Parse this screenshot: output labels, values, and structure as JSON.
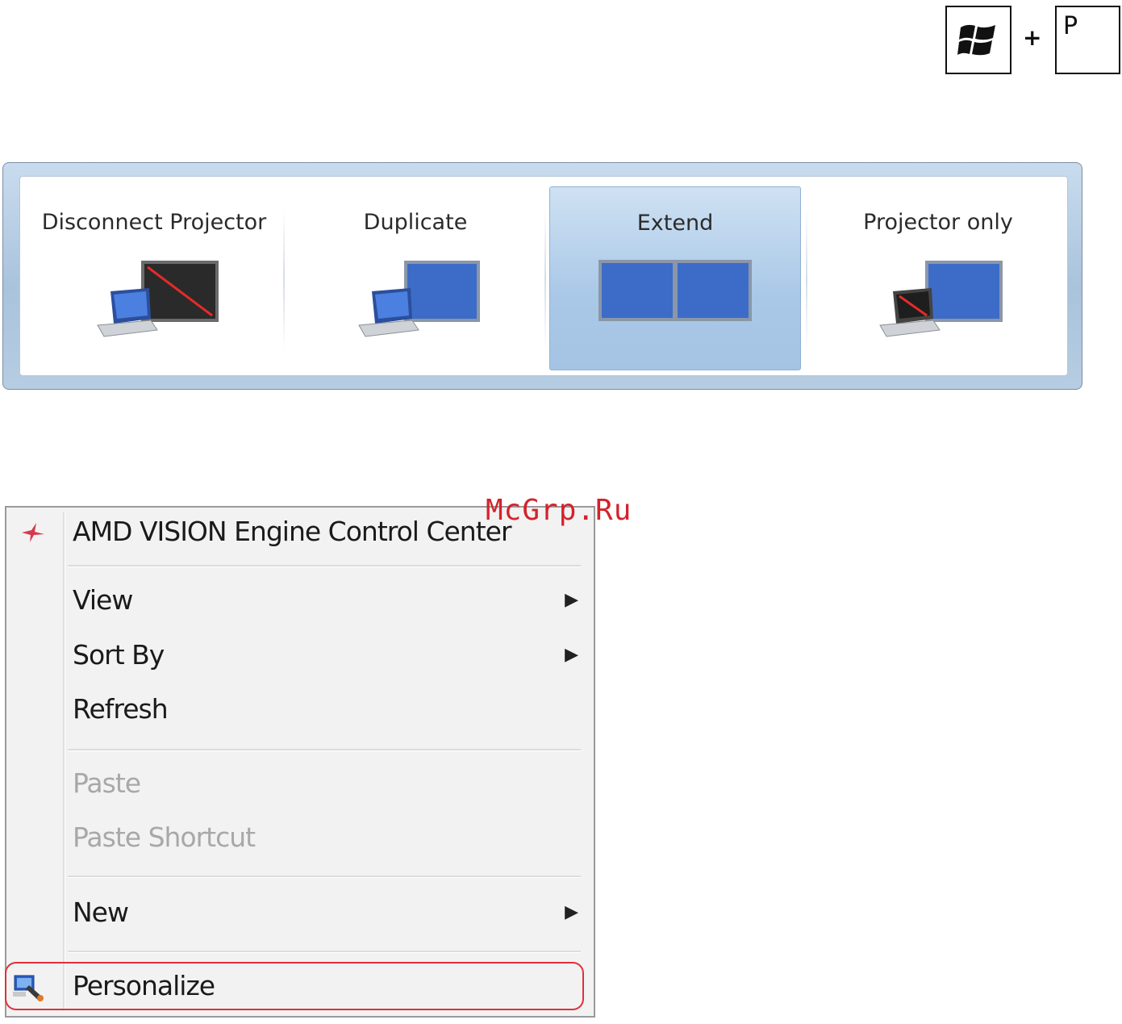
{
  "shortcut": {
    "key_icon": "windows-logo-icon",
    "plus": "+",
    "key_letter": "P"
  },
  "projector": {
    "options": [
      {
        "label": "Disconnect Projector",
        "icon": "disconnect-projector-icon",
        "selected": false
      },
      {
        "label": "Duplicate",
        "icon": "duplicate-icon",
        "selected": false
      },
      {
        "label": "Extend",
        "icon": "extend-icon",
        "selected": true
      },
      {
        "label": "Projector only",
        "icon": "projector-only-icon",
        "selected": false
      }
    ]
  },
  "context_menu": {
    "items": [
      {
        "label": "AMD VISION Engine Control Center",
        "icon": "amd-icon",
        "enabled": true
      },
      {
        "label": "View",
        "submenu": true,
        "enabled": true
      },
      {
        "label": "Sort By",
        "submenu": true,
        "enabled": true
      },
      {
        "label": "Refresh",
        "enabled": true
      },
      {
        "label": "Paste",
        "enabled": false
      },
      {
        "label": "Paste Shortcut",
        "enabled": false
      },
      {
        "label": "New",
        "submenu": true,
        "enabled": true
      },
      {
        "label": "Personalize",
        "icon": "personalize-icon",
        "enabled": true,
        "highlighted": true
      }
    ],
    "submenu_arrow": "▶"
  },
  "watermark": "McGrp.Ru",
  "colors": {
    "highlight_border": "#e0303a",
    "selected_option": "#a9c8e7",
    "screen_blue": "#3d6cc8"
  }
}
